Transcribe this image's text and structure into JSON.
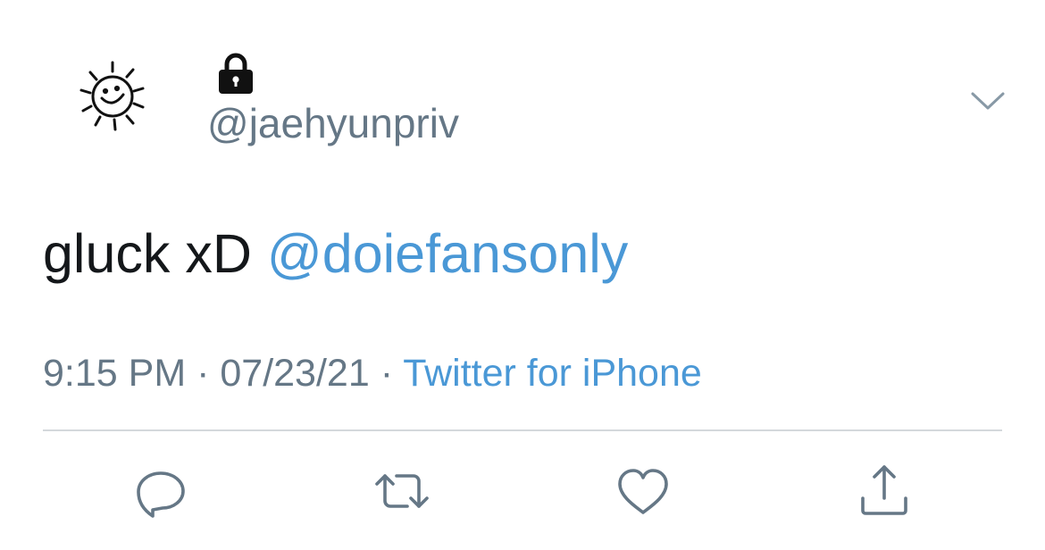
{
  "tweet": {
    "author": {
      "handle": "@jaehyunpriv",
      "avatar_icon": "sun-doodle-avatar",
      "protected_icon": "lock-icon"
    },
    "menu_icon": "chevron-down-icon",
    "text": "gluck xD ",
    "mention": "@doiefansonly",
    "time": "9:15 PM",
    "separator": " · ",
    "date": "07/23/21",
    "source": "Twitter for iPhone",
    "actions": [
      {
        "icon": "reply-icon"
      },
      {
        "icon": "retweet-icon"
      },
      {
        "icon": "like-icon"
      },
      {
        "icon": "share-icon"
      }
    ]
  },
  "colors": {
    "text": "#14171a",
    "secondary": "#657786",
    "link": "#4a98d6",
    "divider": "#d4d8dc"
  }
}
